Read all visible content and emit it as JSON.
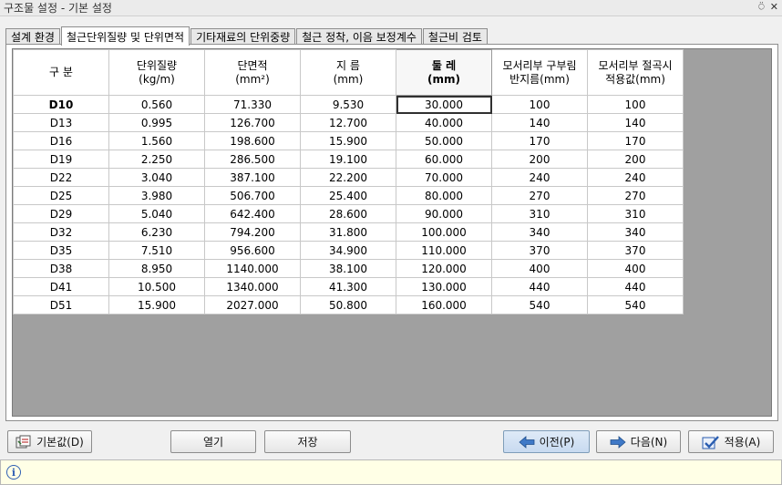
{
  "window": {
    "title": "구조물 설정 - 기본 설정",
    "pin_glyph": "⍥",
    "close_glyph": "✕"
  },
  "tabs": [
    {
      "label": "설계 환경",
      "active": false
    },
    {
      "label": "철근단위질량 및 단위면적",
      "active": true
    },
    {
      "label": "기타재료의 단위중량",
      "active": false
    },
    {
      "label": "철근 정착, 이음 보정계수",
      "active": false
    },
    {
      "label": "철근비 검토",
      "active": false
    }
  ],
  "table": {
    "headers": [
      {
        "line1": "구 분",
        "line2": ""
      },
      {
        "line1": "단위질량",
        "line2": "(kg/m)"
      },
      {
        "line1": "단면적",
        "line2": "(mm²)"
      },
      {
        "line1": "지 름",
        "line2": "(mm)"
      },
      {
        "line1": "둘 레",
        "line2": "(mm)"
      },
      {
        "line1": "모서리부 구부림",
        "line2": "반지름(mm)"
      },
      {
        "line1": "모서리부 절곡시",
        "line2": "적용값(mm)"
      }
    ],
    "rows": [
      [
        "D10",
        "0.560",
        "71.330",
        "9.530",
        "30.000",
        "100",
        "100"
      ],
      [
        "D13",
        "0.995",
        "126.700",
        "12.700",
        "40.000",
        "140",
        "140"
      ],
      [
        "D16",
        "1.560",
        "198.600",
        "15.900",
        "50.000",
        "170",
        "170"
      ],
      [
        "D19",
        "2.250",
        "286.500",
        "19.100",
        "60.000",
        "200",
        "200"
      ],
      [
        "D22",
        "3.040",
        "387.100",
        "22.200",
        "70.000",
        "240",
        "240"
      ],
      [
        "D25",
        "3.980",
        "506.700",
        "25.400",
        "80.000",
        "270",
        "270"
      ],
      [
        "D29",
        "5.040",
        "642.400",
        "28.600",
        "90.000",
        "310",
        "310"
      ],
      [
        "D32",
        "6.230",
        "794.200",
        "31.800",
        "100.000",
        "340",
        "340"
      ],
      [
        "D35",
        "7.510",
        "956.600",
        "34.900",
        "110.000",
        "370",
        "370"
      ],
      [
        "D38",
        "8.950",
        "1140.000",
        "38.100",
        "120.000",
        "400",
        "400"
      ],
      [
        "D41",
        "10.500",
        "1340.000",
        "41.300",
        "130.000",
        "440",
        "440"
      ],
      [
        "D51",
        "15.900",
        "2027.000",
        "50.800",
        "160.000",
        "540",
        "540"
      ]
    ]
  },
  "buttons": {
    "default": "기본값(D)",
    "open": "열기",
    "save": "저장",
    "prev": "이전(P)",
    "next": "다음(N)",
    "apply": "적용(A)"
  },
  "status": {
    "icon": "i",
    "text": ""
  }
}
